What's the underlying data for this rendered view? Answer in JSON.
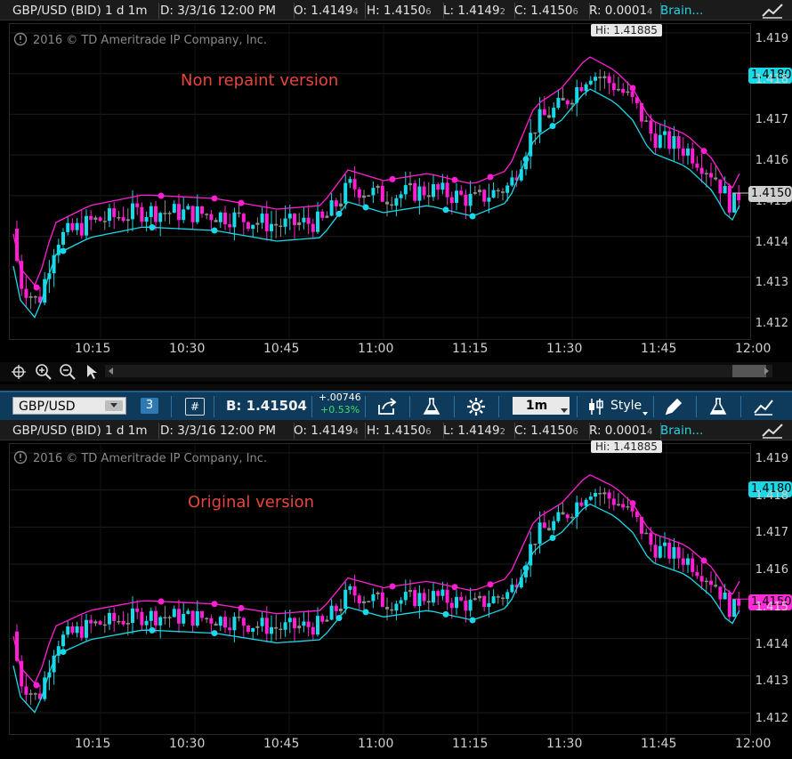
{
  "panels": [
    {
      "header": {
        "symbol": "GBP/USD (BID) 1 d 1m",
        "date": "D: 3/3/16 12:00 PM",
        "open": "O: 1.4149",
        "open_sub": "4",
        "high": "H: 1.4150",
        "high_sub": "6",
        "low": "L: 1.4149",
        "low_sub": "2",
        "close": "C: 1.4150",
        "close_sub": "6",
        "range": "R: 0.0001",
        "range_sub": "4",
        "study": "Brain..."
      },
      "copyright": "2016 © TD Ameritrade IP Company, Inc.",
      "annotation": "Non repaint version",
      "high_tag": "Hi: 1.41885",
      "price_tags": {
        "upper": "1.4180",
        "last": "1.4150"
      },
      "last_tag_color": "#cfcfcf"
    },
    {
      "header": {
        "symbol": "GBP/USD (BID) 1 d 1m",
        "date": "D: 3/3/16 12:00 PM",
        "open": "O: 1.4149",
        "open_sub": "4",
        "high": "H: 1.4150",
        "high_sub": "6",
        "low": "L: 1.4149",
        "low_sub": "2",
        "close": "C: 1.4150",
        "close_sub": "6",
        "range": "R: 0.0001",
        "range_sub": "4",
        "study": "Brain..."
      },
      "copyright": "2016 © TD Ameritrade IP Company, Inc.",
      "annotation": "Original version",
      "high_tag": "Hi: 1.41885",
      "price_tags": {
        "upper": "1.4180",
        "last": "1.4150"
      },
      "last_tag_color": "#ff2bd6"
    }
  ],
  "y_axis": [
    "1.419",
    "1.418",
    "1.417",
    "1.416",
    "1.415",
    "1.414",
    "1.413",
    "1.412"
  ],
  "x_axis": [
    "10:15",
    "10:30",
    "10:45",
    "11:00",
    "11:15",
    "11:30",
    "11:45",
    "12:00"
  ],
  "toolbar": {
    "symbol": "GBP/USD",
    "link_badge": "3",
    "grid_badge": "#",
    "bid": "B: 1.41504",
    "change": "+.00746",
    "change_pct": "+0.53%",
    "timeframe": "1m",
    "style_label": "Style"
  },
  "colors": {
    "up_candle": "#19d9e8",
    "down_candle": "#ff1fd2",
    "neutral_candle": "#8e8e8e",
    "support_line": "#19d9e8",
    "resistance_line": "#ff1fd2",
    "toolbar_bg": "#0e3b5c",
    "annotation": "#e8453c"
  },
  "icons": [
    "alert-icon",
    "crosshair-icon",
    "zoom-in-icon",
    "zoom-out-icon",
    "cursor-icon",
    "share-icon",
    "flask-icon",
    "gear-icon",
    "style-icon",
    "pencil-icon",
    "drawing-tools-icon",
    "dropdown-icon"
  ]
}
